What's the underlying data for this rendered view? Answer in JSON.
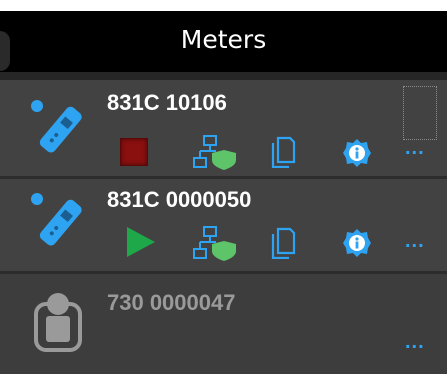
{
  "header": {
    "title": "Meters"
  },
  "meters": [
    {
      "name": "831C 10106",
      "status": "stopped",
      "icons": [
        "meter-device-icon",
        "stop-icon",
        "network-shield-icon",
        "documents-icon",
        "info-icon",
        "more-icon"
      ],
      "more_label": "..."
    },
    {
      "name": "831C 0000050",
      "status": "running",
      "icons": [
        "meter-device-icon",
        "play-icon",
        "network-shield-icon",
        "documents-icon",
        "info-icon",
        "more-icon"
      ],
      "more_label": "..."
    },
    {
      "name": "730 0000047",
      "status": "offline",
      "icons": [
        "offline-meter-icon",
        "more-icon"
      ],
      "more_label": "..."
    }
  ],
  "colors": {
    "background": "#3c3c3c",
    "header": "#000000",
    "accent_blue": "#2ea3f2",
    "stop_red": "#8a0f0f",
    "play_green": "#1ea84a",
    "shield_green": "#5ec46a",
    "offline_text": "#9a9a9a"
  }
}
